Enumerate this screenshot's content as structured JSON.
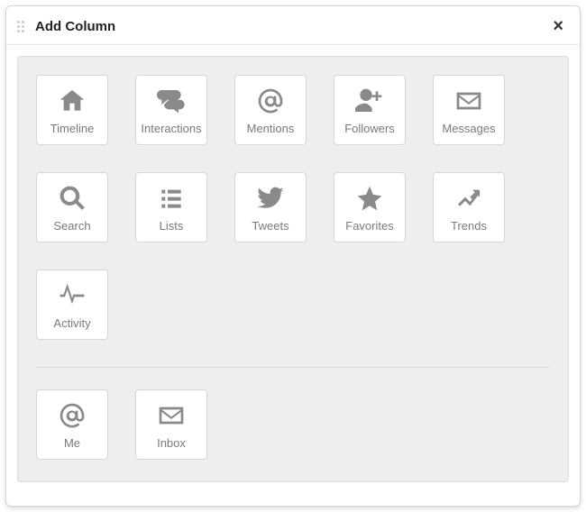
{
  "modal": {
    "title": "Add Column",
    "close_label": "×"
  },
  "groups": [
    {
      "tiles": [
        {
          "key": "timeline",
          "label": "Timeline",
          "icon": "home-icon"
        },
        {
          "key": "interactions",
          "label": "Interactions",
          "icon": "chat-icon"
        },
        {
          "key": "mentions",
          "label": "Mentions",
          "icon": "at-icon"
        },
        {
          "key": "followers",
          "label": "Followers",
          "icon": "user-plus-icon"
        },
        {
          "key": "messages",
          "label": "Messages",
          "icon": "envelope-icon"
        },
        {
          "key": "search",
          "label": "Search",
          "icon": "search-icon"
        },
        {
          "key": "lists",
          "label": "Lists",
          "icon": "list-icon"
        },
        {
          "key": "tweets",
          "label": "Tweets",
          "icon": "bird-icon"
        },
        {
          "key": "favorites",
          "label": "Favorites",
          "icon": "star-icon"
        },
        {
          "key": "trends",
          "label": "Trends",
          "icon": "trend-icon"
        },
        {
          "key": "activity",
          "label": "Activity",
          "icon": "activity-icon"
        }
      ]
    },
    {
      "tiles": [
        {
          "key": "me",
          "label": "Me",
          "icon": "at-icon"
        },
        {
          "key": "inbox",
          "label": "Inbox",
          "icon": "envelope-icon"
        }
      ]
    }
  ]
}
